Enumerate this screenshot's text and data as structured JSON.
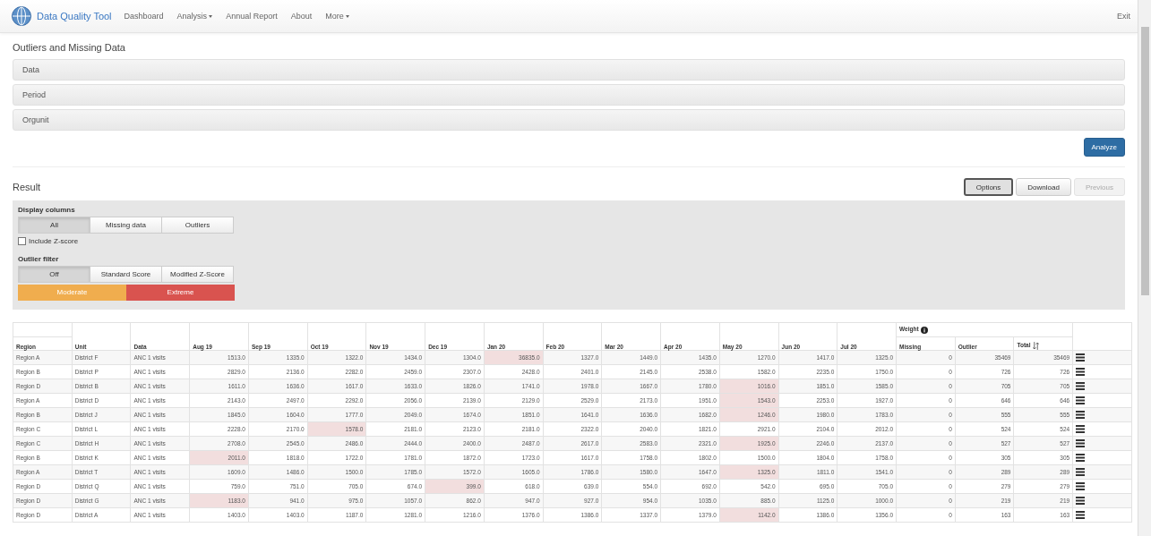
{
  "nav": {
    "brand": "Data Quality Tool",
    "items": [
      {
        "label": "Dashboard",
        "dropdown": false
      },
      {
        "label": "Analysis",
        "dropdown": true
      },
      {
        "label": "Annual Report",
        "dropdown": false
      },
      {
        "label": "About",
        "dropdown": false
      },
      {
        "label": "More",
        "dropdown": true
      }
    ],
    "exit": "Exit"
  },
  "page_title": "Outliers and Missing Data",
  "panels": [
    "Data",
    "Period",
    "Orgunit"
  ],
  "analyze_button": "Analyze",
  "result": {
    "title": "Result",
    "actions": [
      {
        "label": "Options",
        "selected": true,
        "disabled": false
      },
      {
        "label": "Download",
        "selected": false,
        "disabled": false
      },
      {
        "label": "Previous",
        "selected": false,
        "disabled": true
      }
    ]
  },
  "options": {
    "display_columns": {
      "label": "Display columns",
      "options": [
        {
          "label": "All",
          "selected": true
        },
        {
          "label": "Missing data",
          "selected": false
        },
        {
          "label": "Outliers",
          "selected": false
        }
      ]
    },
    "include_zscore": {
      "label": "Include Z-score",
      "checked": false
    },
    "outlier_filter": {
      "label": "Outlier filter",
      "options": [
        {
          "label": "Off",
          "selected": true
        },
        {
          "label": "Standard Score",
          "selected": false
        },
        {
          "label": "Modified Z-Score",
          "selected": false
        }
      ],
      "severity": [
        {
          "label": "Moderate",
          "color": "#f0ad4e"
        },
        {
          "label": "Extreme",
          "color": "#d9534f"
        }
      ]
    }
  },
  "table": {
    "group_header": "Weight",
    "columns": [
      "Region",
      "Unit",
      "Data",
      "Aug 19",
      "Sep 19",
      "Oct 19",
      "Nov 19",
      "Dec 19",
      "Jan 20",
      "Feb 20",
      "Mar 20",
      "Apr 20",
      "May 20",
      "Jun 20",
      "Jul 20",
      "Missing",
      "Outlier",
      "Total"
    ],
    "rows": [
      {
        "region": "Region A",
        "unit": "District F",
        "data": "ANC 1 visits",
        "months": [
          {
            "value": "1513.0",
            "outlier": false
          },
          {
            "value": "1335.0",
            "outlier": false
          },
          {
            "value": "1322.0",
            "outlier": false
          },
          {
            "value": "1434.0",
            "outlier": false
          },
          {
            "value": "1304.0",
            "outlier": false
          },
          {
            "value": "36835.0",
            "outlier": true
          },
          {
            "value": "1327.0",
            "outlier": false
          },
          {
            "value": "1449.0",
            "outlier": false
          },
          {
            "value": "1435.0",
            "outlier": false
          },
          {
            "value": "1270.0",
            "outlier": false
          },
          {
            "value": "1417.0",
            "outlier": false
          },
          {
            "value": "1325.0",
            "outlier": false
          }
        ],
        "missing": "0",
        "outlier": "35469",
        "total": "35469"
      },
      {
        "region": "Region B",
        "unit": "District P",
        "data": "ANC 1 visits",
        "months": [
          {
            "value": "2829.0",
            "outlier": false
          },
          {
            "value": "2136.0",
            "outlier": false
          },
          {
            "value": "2282.0",
            "outlier": false
          },
          {
            "value": "2459.0",
            "outlier": false
          },
          {
            "value": "2307.0",
            "outlier": false
          },
          {
            "value": "2428.0",
            "outlier": false
          },
          {
            "value": "2401.0",
            "outlier": false
          },
          {
            "value": "2145.0",
            "outlier": false
          },
          {
            "value": "2538.0",
            "outlier": false
          },
          {
            "value": "1582.0",
            "outlier": false
          },
          {
            "value": "2235.0",
            "outlier": false
          },
          {
            "value": "1750.0",
            "outlier": false
          }
        ],
        "missing": "0",
        "outlier": "726",
        "total": "726"
      },
      {
        "region": "Region D",
        "unit": "District B",
        "data": "ANC 1 visits",
        "months": [
          {
            "value": "1611.0",
            "outlier": false
          },
          {
            "value": "1636.0",
            "outlier": false
          },
          {
            "value": "1617.0",
            "outlier": false
          },
          {
            "value": "1633.0",
            "outlier": false
          },
          {
            "value": "1826.0",
            "outlier": false
          },
          {
            "value": "1741.0",
            "outlier": false
          },
          {
            "value": "1978.0",
            "outlier": false
          },
          {
            "value": "1667.0",
            "outlier": false
          },
          {
            "value": "1780.0",
            "outlier": false
          },
          {
            "value": "1016.0",
            "outlier": true
          },
          {
            "value": "1851.0",
            "outlier": false
          },
          {
            "value": "1585.0",
            "outlier": false
          }
        ],
        "missing": "0",
        "outlier": "705",
        "total": "705"
      },
      {
        "region": "Region A",
        "unit": "District D",
        "data": "ANC 1 visits",
        "months": [
          {
            "value": "2143.0",
            "outlier": false
          },
          {
            "value": "2497.0",
            "outlier": false
          },
          {
            "value": "2292.0",
            "outlier": false
          },
          {
            "value": "2056.0",
            "outlier": false
          },
          {
            "value": "2139.0",
            "outlier": false
          },
          {
            "value": "2129.0",
            "outlier": false
          },
          {
            "value": "2529.0",
            "outlier": false
          },
          {
            "value": "2173.0",
            "outlier": false
          },
          {
            "value": "1951.0",
            "outlier": false
          },
          {
            "value": "1543.0",
            "outlier": true
          },
          {
            "value": "2253.0",
            "outlier": false
          },
          {
            "value": "1927.0",
            "outlier": false
          }
        ],
        "missing": "0",
        "outlier": "646",
        "total": "646"
      },
      {
        "region": "Region B",
        "unit": "District J",
        "data": "ANC 1 visits",
        "months": [
          {
            "value": "1845.0",
            "outlier": false
          },
          {
            "value": "1604.0",
            "outlier": false
          },
          {
            "value": "1777.0",
            "outlier": false
          },
          {
            "value": "2049.0",
            "outlier": false
          },
          {
            "value": "1674.0",
            "outlier": false
          },
          {
            "value": "1851.0",
            "outlier": false
          },
          {
            "value": "1641.0",
            "outlier": false
          },
          {
            "value": "1636.0",
            "outlier": false
          },
          {
            "value": "1682.0",
            "outlier": false
          },
          {
            "value": "1246.0",
            "outlier": true
          },
          {
            "value": "1980.0",
            "outlier": false
          },
          {
            "value": "1783.0",
            "outlier": false
          }
        ],
        "missing": "0",
        "outlier": "555",
        "total": "555"
      },
      {
        "region": "Region C",
        "unit": "District L",
        "data": "ANC 1 visits",
        "months": [
          {
            "value": "2228.0",
            "outlier": false
          },
          {
            "value": "2170.0",
            "outlier": false
          },
          {
            "value": "1578.0",
            "outlier": true
          },
          {
            "value": "2181.0",
            "outlier": false
          },
          {
            "value": "2123.0",
            "outlier": false
          },
          {
            "value": "2181.0",
            "outlier": false
          },
          {
            "value": "2322.0",
            "outlier": false
          },
          {
            "value": "2040.0",
            "outlier": false
          },
          {
            "value": "1821.0",
            "outlier": false
          },
          {
            "value": "2921.0",
            "outlier": false
          },
          {
            "value": "2104.0",
            "outlier": false
          },
          {
            "value": "2012.0",
            "outlier": false
          }
        ],
        "missing": "0",
        "outlier": "524",
        "total": "524"
      },
      {
        "region": "Region C",
        "unit": "District H",
        "data": "ANC 1 visits",
        "months": [
          {
            "value": "2708.0",
            "outlier": false
          },
          {
            "value": "2545.0",
            "outlier": false
          },
          {
            "value": "2486.0",
            "outlier": false
          },
          {
            "value": "2444.0",
            "outlier": false
          },
          {
            "value": "2400.0",
            "outlier": false
          },
          {
            "value": "2487.0",
            "outlier": false
          },
          {
            "value": "2617.0",
            "outlier": false
          },
          {
            "value": "2583.0",
            "outlier": false
          },
          {
            "value": "2321.0",
            "outlier": false
          },
          {
            "value": "1925.0",
            "outlier": true
          },
          {
            "value": "2246.0",
            "outlier": false
          },
          {
            "value": "2137.0",
            "outlier": false
          }
        ],
        "missing": "0",
        "outlier": "527",
        "total": "527"
      },
      {
        "region": "Region B",
        "unit": "District K",
        "data": "ANC 1 visits",
        "months": [
          {
            "value": "2011.0",
            "outlier": true
          },
          {
            "value": "1818.0",
            "outlier": false
          },
          {
            "value": "1722.0",
            "outlier": false
          },
          {
            "value": "1781.0",
            "outlier": false
          },
          {
            "value": "1872.0",
            "outlier": false
          },
          {
            "value": "1723.0",
            "outlier": false
          },
          {
            "value": "1617.0",
            "outlier": false
          },
          {
            "value": "1758.0",
            "outlier": false
          },
          {
            "value": "1802.0",
            "outlier": false
          },
          {
            "value": "1500.0",
            "outlier": false
          },
          {
            "value": "1804.0",
            "outlier": false
          },
          {
            "value": "1758.0",
            "outlier": false
          }
        ],
        "missing": "0",
        "outlier": "305",
        "total": "305"
      },
      {
        "region": "Region A",
        "unit": "District T",
        "data": "ANC 1 visits",
        "months": [
          {
            "value": "1609.0",
            "outlier": false
          },
          {
            "value": "1486.0",
            "outlier": false
          },
          {
            "value": "1500.0",
            "outlier": false
          },
          {
            "value": "1785.0",
            "outlier": false
          },
          {
            "value": "1572.0",
            "outlier": false
          },
          {
            "value": "1605.0",
            "outlier": false
          },
          {
            "value": "1786.0",
            "outlier": false
          },
          {
            "value": "1580.0",
            "outlier": false
          },
          {
            "value": "1647.0",
            "outlier": false
          },
          {
            "value": "1325.0",
            "outlier": true
          },
          {
            "value": "1811.0",
            "outlier": false
          },
          {
            "value": "1541.0",
            "outlier": false
          }
        ],
        "missing": "0",
        "outlier": "289",
        "total": "289"
      },
      {
        "region": "Region D",
        "unit": "District Q",
        "data": "ANC 1 visits",
        "months": [
          {
            "value": "759.0",
            "outlier": false
          },
          {
            "value": "751.0",
            "outlier": false
          },
          {
            "value": "705.0",
            "outlier": false
          },
          {
            "value": "674.0",
            "outlier": false
          },
          {
            "value": "399.0",
            "outlier": true
          },
          {
            "value": "618.0",
            "outlier": false
          },
          {
            "value": "639.0",
            "outlier": false
          },
          {
            "value": "554.0",
            "outlier": false
          },
          {
            "value": "692.0",
            "outlier": false
          },
          {
            "value": "542.0",
            "outlier": false
          },
          {
            "value": "695.0",
            "outlier": false
          },
          {
            "value": "705.0",
            "outlier": false
          }
        ],
        "missing": "0",
        "outlier": "279",
        "total": "279"
      },
      {
        "region": "Region D",
        "unit": "District G",
        "data": "ANC 1 visits",
        "months": [
          {
            "value": "1183.0",
            "outlier": true
          },
          {
            "value": "941.0",
            "outlier": false
          },
          {
            "value": "975.0",
            "outlier": false
          },
          {
            "value": "1057.0",
            "outlier": false
          },
          {
            "value": "862.0",
            "outlier": false
          },
          {
            "value": "947.0",
            "outlier": false
          },
          {
            "value": "927.0",
            "outlier": false
          },
          {
            "value": "954.0",
            "outlier": false
          },
          {
            "value": "1035.0",
            "outlier": false
          },
          {
            "value": "885.0",
            "outlier": false
          },
          {
            "value": "1125.0",
            "outlier": false
          },
          {
            "value": "1000.0",
            "outlier": false
          }
        ],
        "missing": "0",
        "outlier": "219",
        "total": "219"
      },
      {
        "region": "Region D",
        "unit": "District A",
        "data": "ANC 1 visits",
        "months": [
          {
            "value": "1403.0",
            "outlier": false
          },
          {
            "value": "1403.0",
            "outlier": false
          },
          {
            "value": "1187.0",
            "outlier": false
          },
          {
            "value": "1281.0",
            "outlier": false
          },
          {
            "value": "1216.0",
            "outlier": false
          },
          {
            "value": "1376.0",
            "outlier": false
          },
          {
            "value": "1386.0",
            "outlier": false
          },
          {
            "value": "1337.0",
            "outlier": false
          },
          {
            "value": "1379.0",
            "outlier": false
          },
          {
            "value": "1142.0",
            "outlier": true
          },
          {
            "value": "1386.0",
            "outlier": false
          },
          {
            "value": "1356.0",
            "outlier": false
          }
        ],
        "missing": "0",
        "outlier": "163",
        "total": "163"
      }
    ]
  }
}
